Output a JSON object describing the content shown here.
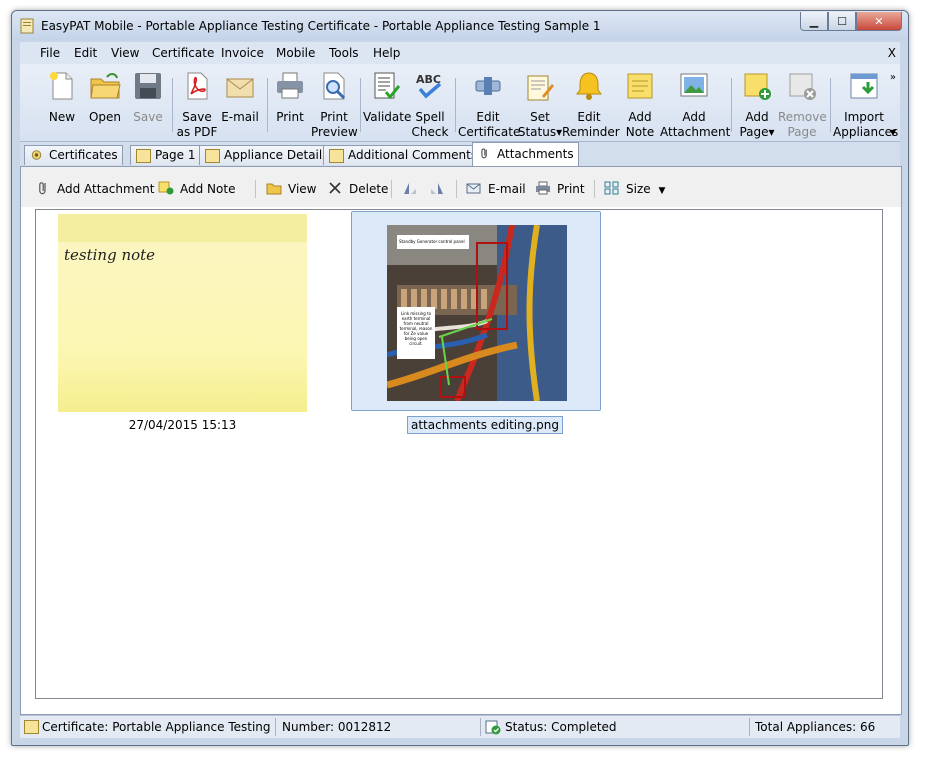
{
  "window": {
    "title": "EasyPAT Mobile - Portable Appliance Testing Certificate - Portable Appliance Testing Sample 1"
  },
  "menu": {
    "items": [
      "File",
      "Edit",
      "View",
      "Certificate",
      "Invoice",
      "Mobile",
      "Tools",
      "Help"
    ],
    "close_label": "X"
  },
  "toolbar": {
    "buttons": [
      {
        "line1": "New",
        "line2": "",
        "icon": "new-document-icon"
      },
      {
        "line1": "Open",
        "line2": "",
        "icon": "open-folder-icon"
      },
      {
        "line1": "Save",
        "line2": "",
        "icon": "save-disk-icon",
        "disabled": true
      },
      {
        "line1": "Save",
        "line2": "as PDF",
        "icon": "pdf-icon"
      },
      {
        "line1": "E-mail",
        "line2": "",
        "icon": "envelope-icon"
      },
      {
        "line1": "Print",
        "line2": "",
        "icon": "printer-icon"
      },
      {
        "line1": "Print",
        "line2": "Preview",
        "icon": "print-preview-icon"
      },
      {
        "line1": "Validate",
        "line2": "",
        "icon": "validate-icon"
      },
      {
        "line1": "Spell",
        "line2": "Check",
        "icon": "spell-check-icon"
      },
      {
        "line1": "Edit",
        "line2": "Certificate",
        "icon": "edit-certificate-icon"
      },
      {
        "line1": "Set",
        "line2": "Status▾",
        "icon": "set-status-icon"
      },
      {
        "line1": "Edit",
        "line2": "Reminder",
        "icon": "bell-icon"
      },
      {
        "line1": "Add",
        "line2": "Note",
        "icon": "note-icon"
      },
      {
        "line1": "Add",
        "line2": "Attachment",
        "icon": "picture-icon"
      },
      {
        "line1": "Add",
        "line2": "Page▾",
        "icon": "add-page-icon"
      },
      {
        "line1": "Remove",
        "line2": "Page",
        "icon": "remove-page-icon",
        "disabled": true
      },
      {
        "line1": "Import",
        "line2": "Appliances",
        "icon": "import-icon"
      }
    ]
  },
  "tabs": [
    {
      "label": "Certificates",
      "icon": "certificates-icon"
    },
    {
      "label": "Page 1",
      "icon": "page-icon"
    },
    {
      "label": "Appliance Details",
      "icon": "page-icon"
    },
    {
      "label": "Additional Comments",
      "icon": "page-icon"
    },
    {
      "label": "Attachments",
      "icon": "paperclip-icon",
      "active": true
    }
  ],
  "attachments_toolbar": {
    "add_attachment": "Add Attachment",
    "add_note": "Add Note",
    "view": "View",
    "delete": "Delete",
    "email": "E-mail",
    "print": "Print",
    "size": "Size"
  },
  "attachments": {
    "note": {
      "text": "testing note",
      "caption": "27/04/2015 15:13"
    },
    "image": {
      "caption": "attachments editing.png",
      "label_top": "Standby Generator control panel",
      "label_side": "Link missing to earth terminal from neutral terminal, reason for Ze value being open circuit."
    }
  },
  "status": {
    "certificate": "Certificate: Portable Appliance Testing Certificate",
    "number": "Number: 0012812",
    "status": "Status: Completed",
    "total": "Total Appliances: 66"
  }
}
